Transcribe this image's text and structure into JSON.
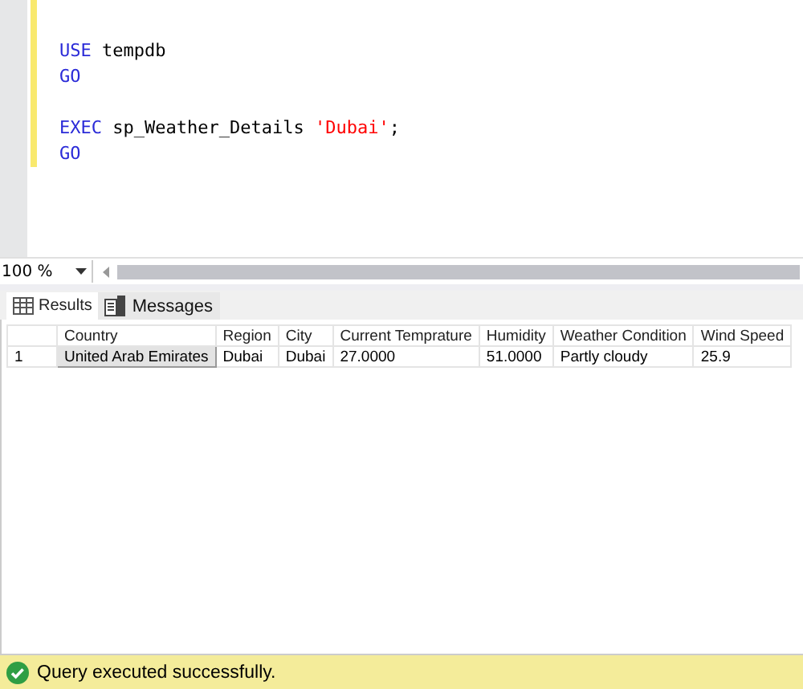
{
  "editor": {
    "lines": [
      {
        "kind": "code",
        "tokens": [
          {
            "kind": "keyword",
            "text": "USE"
          },
          {
            "kind": "plain",
            "text": " tempdb"
          }
        ]
      },
      {
        "kind": "code",
        "tokens": [
          {
            "kind": "keyword",
            "text": "GO"
          }
        ]
      },
      {
        "kind": "blank"
      },
      {
        "kind": "code",
        "tokens": [
          {
            "kind": "keyword",
            "text": "EXEC"
          },
          {
            "kind": "plain",
            "text": " sp_Weather_Details "
          },
          {
            "kind": "string",
            "text": "'Dubai'"
          },
          {
            "kind": "plain",
            "text": ";"
          }
        ]
      },
      {
        "kind": "code",
        "tokens": [
          {
            "kind": "keyword",
            "text": "GO"
          }
        ]
      }
    ]
  },
  "zoom": {
    "value": "100 %"
  },
  "tabs": [
    {
      "label": "Results",
      "selected": true
    },
    {
      "label": "Messages",
      "selected": false
    }
  ],
  "table": {
    "columns": [
      "Country",
      "Region",
      "City",
      "Current Temprature",
      "Humidity",
      "Weather Condition",
      "Wind Speed"
    ],
    "rows": [
      {
        "number": "1",
        "cells": [
          {
            "text": "United Arab Emirates",
            "selected": true
          },
          {
            "text": "Dubai",
            "selected": false
          },
          {
            "text": "Dubai",
            "selected": false
          },
          {
            "text": "27.0000",
            "selected": false
          },
          {
            "text": "51.0000",
            "selected": false
          },
          {
            "text": "Partly cloudy",
            "selected": false
          },
          {
            "text": "25.9",
            "selected": false
          }
        ]
      }
    ]
  },
  "status_bar": {
    "message": "Query executed successfully."
  }
}
